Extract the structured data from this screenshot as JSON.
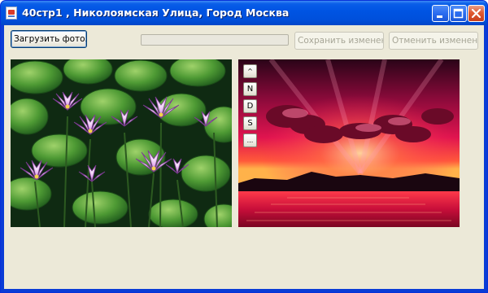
{
  "window": {
    "title": "40стр1 , Николоямская Улица, Город Москва",
    "icon": "document-icon",
    "controls": {
      "minimize_icon": "minimize-icon",
      "maximize_icon": "maximize-icon",
      "close_icon": "close-icon"
    }
  },
  "toolbar": {
    "load_label": "Загрузить фото...",
    "save_label": "Сохранить изменения",
    "cancel_label": "Отменить изменения",
    "progress_value": 0
  },
  "photos": {
    "left": "water-lilies-photo",
    "right": "sunset-photo"
  },
  "side_buttons": {
    "up": "^",
    "n": "N",
    "d": "D",
    "s": "S",
    "more": "..."
  },
  "colors": {
    "titlebar": "#0054e3",
    "client_bg": "#ece9d8",
    "close_btn": "#e05a32"
  }
}
